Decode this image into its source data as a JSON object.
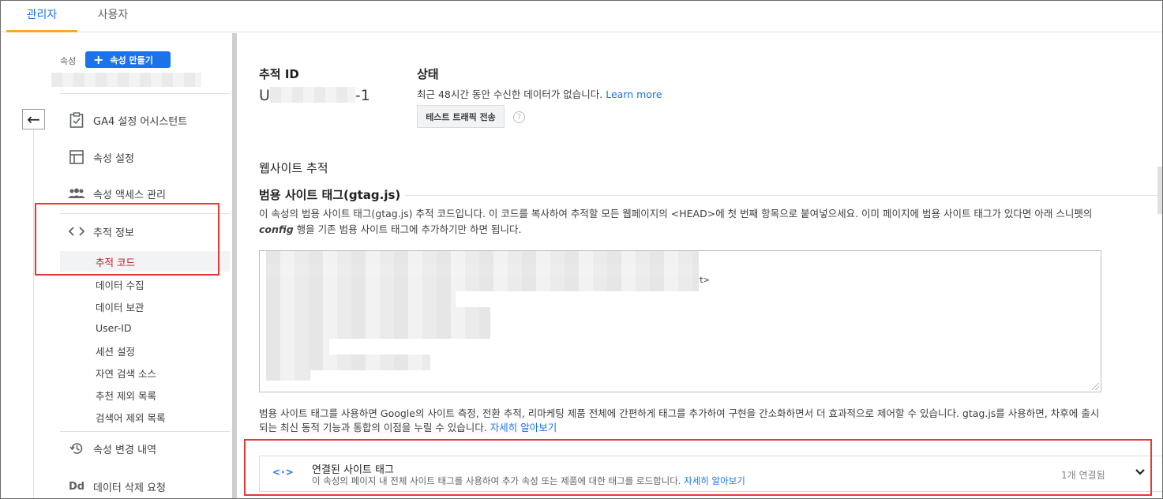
{
  "tabs": [
    {
      "label": "관리자",
      "active": true
    },
    {
      "label": "사용자",
      "active": false
    }
  ],
  "sidebar": {
    "property_label": "속성",
    "create_button_label": "속성 만들기",
    "nav_items": [
      {
        "label": "GA4 설정 어시스턴트",
        "icon": "checklist-icon"
      },
      {
        "label": "속성 설정",
        "icon": "layout-icon"
      },
      {
        "label": "속성 액세스 관리",
        "icon": "people-icon"
      },
      {
        "label": "추적 정보",
        "icon": "code-icon"
      }
    ],
    "sub_items": [
      {
        "label": "추적 코드",
        "active": true
      },
      {
        "label": "데이터 수집"
      },
      {
        "label": "데이터 보관"
      },
      {
        "label": "User-ID"
      },
      {
        "label": "세션 설정"
      },
      {
        "label": "자연 검색 소스"
      },
      {
        "label": "추천 제외 목록"
      },
      {
        "label": "검색어 제외 목록"
      }
    ],
    "bottom_items": [
      {
        "label": "속성 변경 내역",
        "icon": "history-icon"
      },
      {
        "label": "데이터 삭제 요청",
        "icon": "dd-icon",
        "icon_text": "Dd"
      }
    ]
  },
  "main": {
    "tracking_id_label": "추적 ID",
    "tracking_id_prefix": "U",
    "tracking_id_suffix": "-1",
    "status_label": "상태",
    "status_text": "최근 48시간 동안 수신한 데이터가 없습니다.",
    "learn_more": "Learn more",
    "test_button": "테스트 트래픽 전송",
    "help_glyph": "?",
    "website_tracking_title": "웹사이트 추적",
    "gtag_title": "범용 사이트 태그(gtag.js)",
    "gtag_desc_line1": "이 속성의 범용 사이트 태그(gtag.js) 추적 코드입니다. 이 코드를 복사하여 추적할 모든 웹페이지의 <HEAD>에 첫 번째 항목으로 붙여넣으세요. 이미 페이지에 범용 사이트 태그가 있다면 아래 스니펫의",
    "gtag_desc_line2_bold": "config",
    "gtag_desc_line2_rest": " 행을 기존 범용 사이트 태그에 추가하기만 하면 됩니다.",
    "code_tail_1": "t>",
    "code_tail_2": "",
    "bottom_desc_line1": "범용 사이트 태그를 사용하면 Google의 사이트 측정, 전환 추적, 리마케팅 제품 전체에 간편하게 태그를 추가하여 구현을 간소화하면서 더 효과적으로 제어할 수 있습니다. gtag.js를 사용하면, 차후에 출시",
    "bottom_desc_line2": "되는 최신 동적 기능과 통합의 이점을 누릴 수 있습니다.",
    "bottom_desc_link": "자세히 알아보기",
    "connected": {
      "icon_text": "<·>",
      "title": "연결된 사이트 태그",
      "subtitle": "이 속성의 페이지 내 전체 사이트 태그를 사용하여 추가 속성 또는 제품에 대한 태그를 로드합니다.",
      "subtitle_link": "자세히 알아보기",
      "count": "1개 연결됨"
    }
  },
  "colors": {
    "accent": "#1a73e8",
    "highlight_box": "#e53935",
    "active_sub": "#b22222"
  }
}
